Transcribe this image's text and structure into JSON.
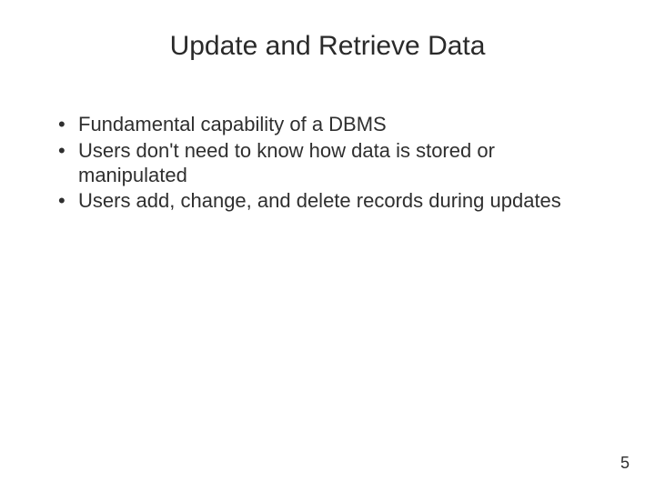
{
  "title": "Update and Retrieve Data",
  "bullets": [
    "Fundamental capability of a DBMS",
    "Users don't need to know how data is stored or manipulated",
    "Users add, change, and delete records during updates"
  ],
  "page_number": "5"
}
